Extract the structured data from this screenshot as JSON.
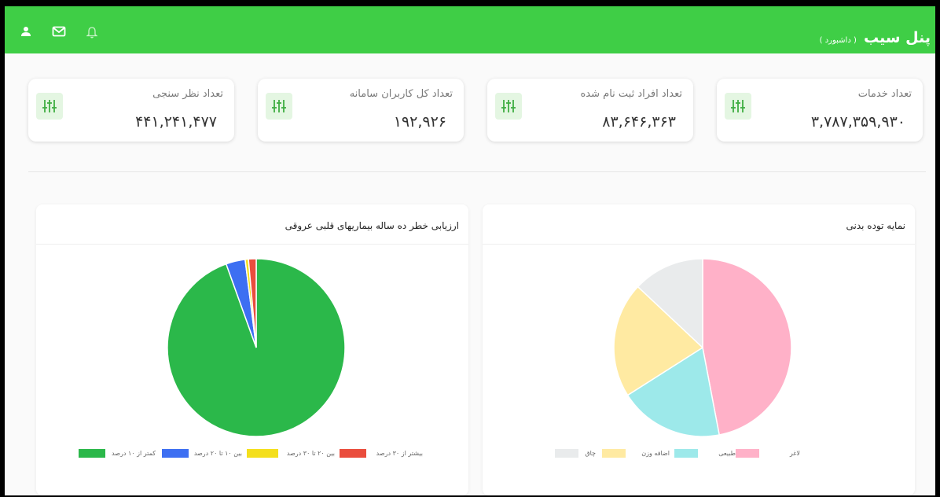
{
  "header": {
    "brand_name": "پنل سیب",
    "brand_sub": "( داشبورد )",
    "icons": [
      "user-icon",
      "mail-icon",
      "bell-icon"
    ],
    "color": "#3fce46"
  },
  "stats": [
    {
      "title": "تعداد خدمات",
      "value": "۳,۷۸۷,۳۵۹,۹۳۰",
      "icon": "sliders-icon"
    },
    {
      "title": "تعداد افراد ثبت نام شده",
      "value": "۸۳,۶۴۶,۳۶۳",
      "icon": "sliders-icon"
    },
    {
      "title": "تعداد کل کاربران سامانه",
      "value": "۱۹۲,۹۲۶",
      "icon": "sliders-icon"
    },
    {
      "title": "تعداد نظر سنجی",
      "value": "۴۴۱,۲۴۱,۴۷۷",
      "icon": "sliders-icon"
    }
  ],
  "chart_data": [
    {
      "type": "pie",
      "title": "نمایه توده بدنی",
      "categories": [
        "لاغر",
        "طبیعی",
        "اضافه وزن",
        "چاق"
      ],
      "values": [
        47,
        19,
        21,
        13
      ],
      "colors": [
        "#ffb1c8",
        "#9de9ea",
        "#ffeaa2",
        "#e9ebec"
      ]
    },
    {
      "type": "pie",
      "title": "ارزیابی خطر ده ساله بیماریهای قلبی عروقی",
      "categories": [
        "کمتر از ۱۰ درصد",
        "بین ۱۰ تا ۲۰ درصد",
        "بین ۲۰ تا ۳۰ درصد",
        "بیشتر از ۳۰ درصد"
      ],
      "values": [
        94.5,
        3.5,
        0.6,
        1.4
      ],
      "colors": [
        "#2bb84a",
        "#3d6ff2",
        "#f4df1c",
        "#ea4d3d"
      ]
    }
  ]
}
